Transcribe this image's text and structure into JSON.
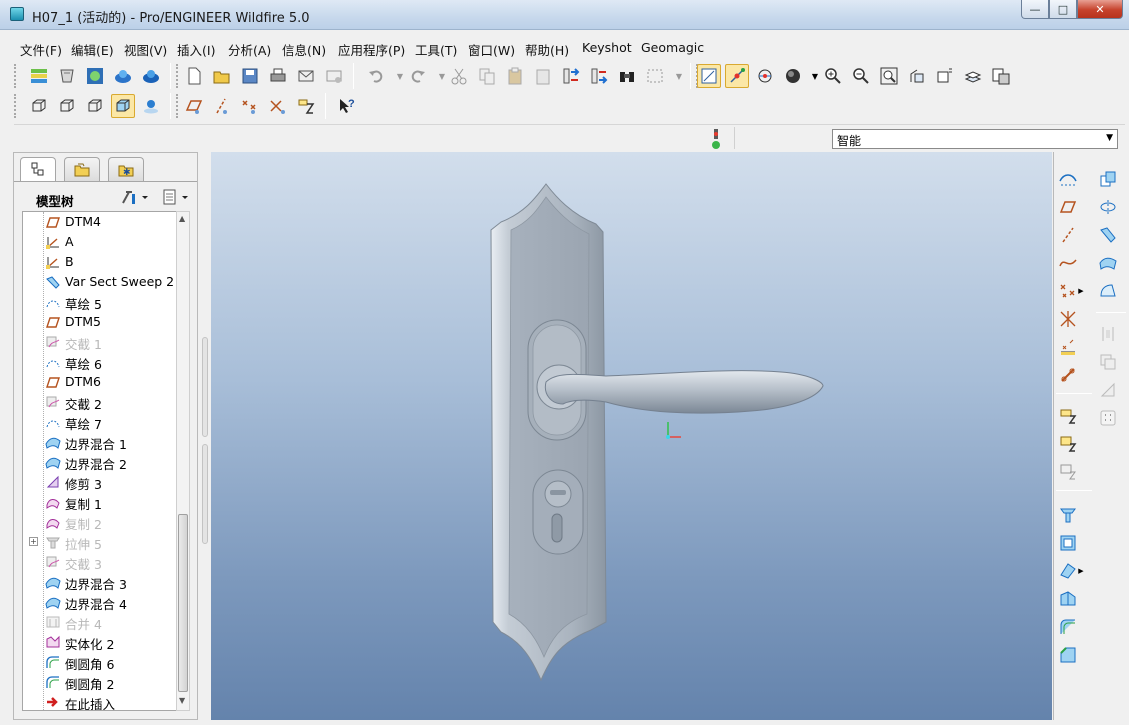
{
  "window": {
    "title": "H07_1 (活动的) - Pro/ENGINEER Wildfire 5.0",
    "minimize": "—",
    "maximize": "□",
    "close": "✕"
  },
  "menu": [
    "文件(F)",
    "编辑(E)",
    "视图(V)",
    "插入(I)",
    "分析(A)",
    "信息(N)",
    "应用程序(P)",
    "工具(T)",
    "窗口(W)",
    "帮助(H)",
    "Keyshot",
    "Geomagic"
  ],
  "filter": {
    "value": "智能"
  },
  "navigator": {
    "tabs": [
      "model-tree-tab",
      "folder-browser-tab",
      "favorites-tab"
    ],
    "tree_title": "模型树",
    "items": [
      {
        "label": "DTM4",
        "icon": "datum-plane-icon",
        "dim": false
      },
      {
        "label": "A",
        "icon": "datum-axis-icon",
        "dim": false
      },
      {
        "label": "B",
        "icon": "datum-axis-icon",
        "dim": false
      },
      {
        "label": "Var Sect Sweep 2",
        "icon": "sweep-icon",
        "dim": false
      },
      {
        "label": "草绘 5",
        "icon": "sketch-icon",
        "dim": false
      },
      {
        "label": "DTM5",
        "icon": "datum-plane-icon",
        "dim": false
      },
      {
        "label": "交截 1",
        "icon": "intersect-icon",
        "dim": true
      },
      {
        "label": "草绘 6",
        "icon": "sketch-icon",
        "dim": false
      },
      {
        "label": "DTM6",
        "icon": "datum-plane-icon",
        "dim": false
      },
      {
        "label": "交截 2",
        "icon": "intersect-icon",
        "dim": false
      },
      {
        "label": "草绘 7",
        "icon": "sketch-icon",
        "dim": false
      },
      {
        "label": "边界混合 1",
        "icon": "boundary-blend-icon",
        "dim": false
      },
      {
        "label": "边界混合 2",
        "icon": "boundary-blend-icon",
        "dim": false
      },
      {
        "label": "修剪 3",
        "icon": "trim-icon",
        "dim": false
      },
      {
        "label": "复制 1",
        "icon": "copy-icon",
        "dim": false
      },
      {
        "label": "复制 2",
        "icon": "copy-icon",
        "dim": true
      },
      {
        "label": "拉伸 5",
        "icon": "extrude-icon",
        "dim": true,
        "expandable": true
      },
      {
        "label": "交截 3",
        "icon": "intersect-icon",
        "dim": true
      },
      {
        "label": "边界混合 3",
        "icon": "boundary-blend-icon",
        "dim": false
      },
      {
        "label": "边界混合 4",
        "icon": "boundary-blend-icon",
        "dim": false
      },
      {
        "label": "合并 4",
        "icon": "merge-icon",
        "dim": true
      },
      {
        "label": "实体化 2",
        "icon": "solidify-icon",
        "dim": false
      },
      {
        "label": "倒圆角 6",
        "icon": "round-icon",
        "dim": false
      },
      {
        "label": "倒圆角 2",
        "icon": "round-icon",
        "dim": false
      },
      {
        "label": "在此插入",
        "icon": "insert-here-arrow-icon",
        "dim": false
      }
    ]
  },
  "colors": {
    "viewport_top": "#d2deec",
    "viewport_bottom": "#6483ac",
    "model_gray": "#b9c2cc",
    "accent_active": "#fbe7a6"
  }
}
